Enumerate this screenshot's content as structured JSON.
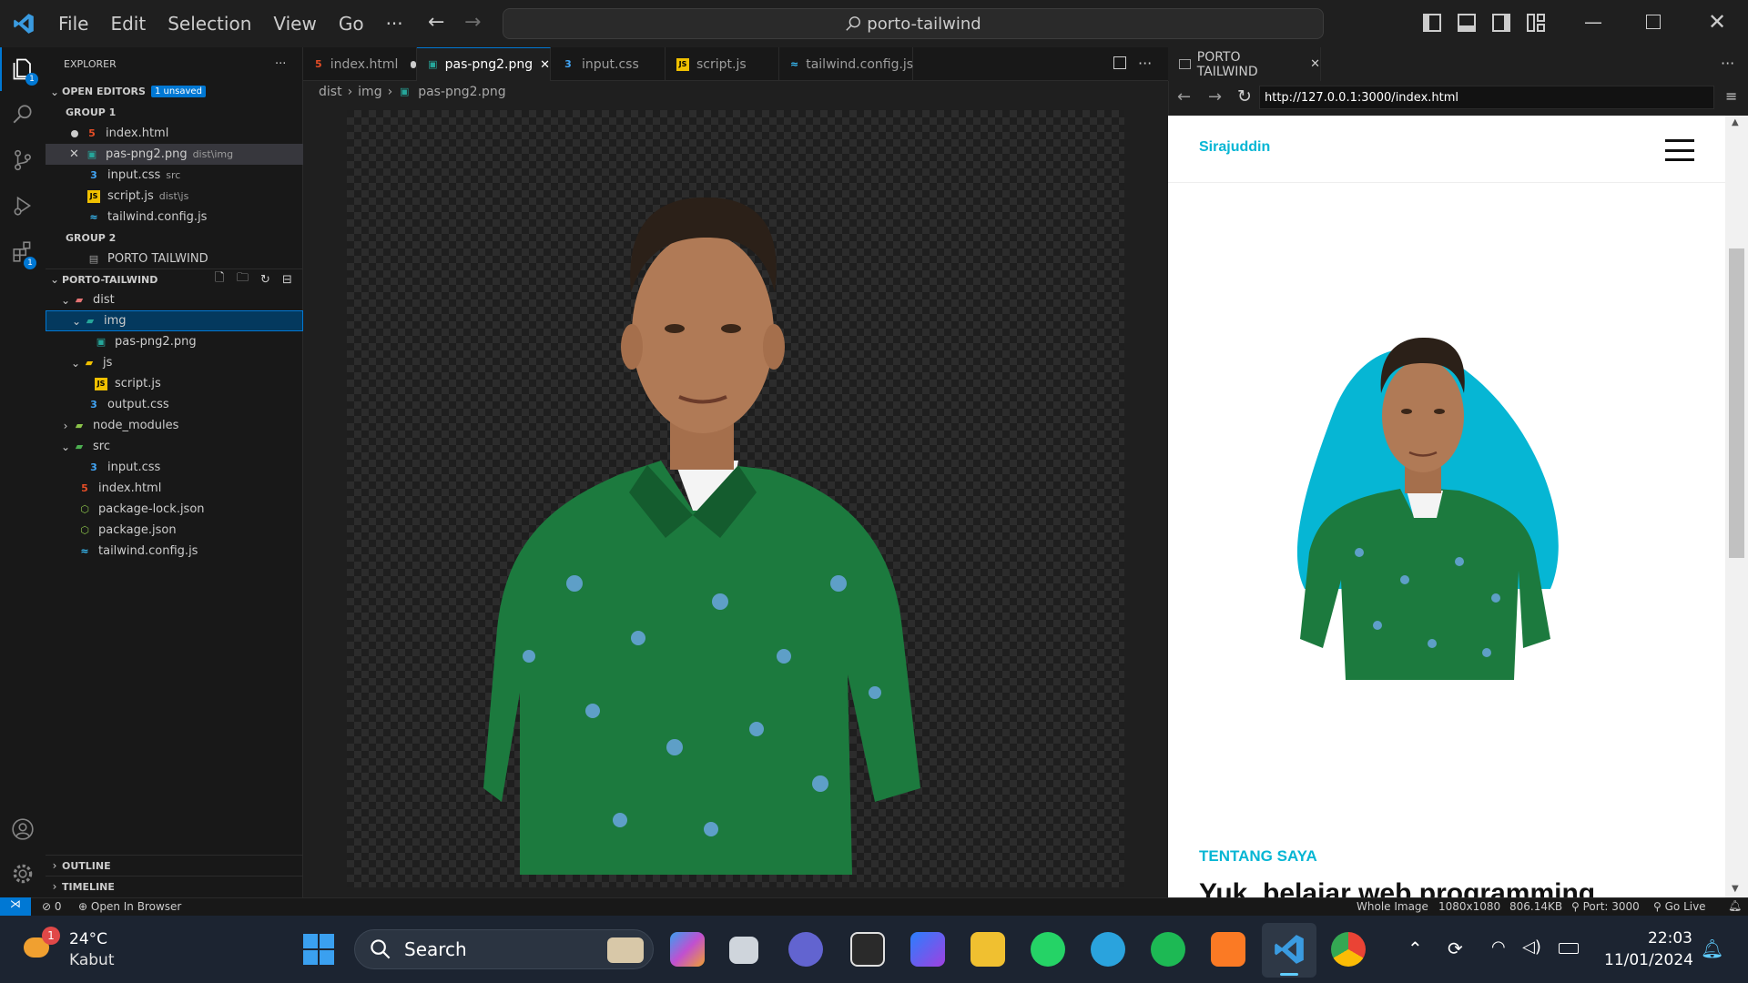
{
  "menu": {
    "file": "File",
    "edit": "Edit",
    "selection": "Selection",
    "view": "View",
    "go": "Go",
    "more": "···"
  },
  "command_center": {
    "text": "porto-tailwind"
  },
  "explorer": {
    "title": "EXPLORER",
    "open_editors": {
      "label": "OPEN EDITORS",
      "badge": "1 unsaved",
      "group1": "GROUP 1",
      "files": [
        {
          "name": "index.html",
          "desc": ""
        },
        {
          "name": "pas-png2.png",
          "desc": "dist\\img"
        },
        {
          "name": "input.css",
          "desc": "src"
        },
        {
          "name": "script.js",
          "desc": "dist\\js"
        },
        {
          "name": "tailwind.config.js",
          "desc": ""
        }
      ],
      "group2": "GROUP 2",
      "group2_item": "PORTO TAILWIND"
    },
    "project": {
      "label": "PORTO-TAILWIND",
      "tree": [
        "dist",
        "img",
        "pas-png2.png",
        "js",
        "script.js",
        "output.css",
        "node_modules",
        "src",
        "input.css",
        "index.html",
        "package-lock.json",
        "package.json",
        "tailwind.config.js"
      ]
    },
    "outline": "OUTLINE",
    "timeline": "TIMELINE"
  },
  "tabs": [
    {
      "label": "index.html"
    },
    {
      "label": "pas-png2.png"
    },
    {
      "label": "input.css"
    },
    {
      "label": "script.js"
    },
    {
      "label": "tailwind.config.js"
    }
  ],
  "breadcrumb": {
    "p1": "dist",
    "p2": "img",
    "p3": "pas-png2.png"
  },
  "preview": {
    "tab": "PORTO TAILWIND",
    "url": "http://127.0.0.1:3000/index.html",
    "brand": "Sirajuddin",
    "section": "TENTANG SAYA",
    "heading": "Yuk, belajar web programming"
  },
  "status": {
    "problems": "0",
    "open_browser": "Open In Browser",
    "whole_image": "Whole Image",
    "dims": "1080x1080",
    "size": "806.14KB",
    "port": "Port: 3000",
    "golive": "Go Live"
  },
  "taskbar": {
    "notif_count": "1",
    "temp": "24°C",
    "weather": "Kabut",
    "search": "Search",
    "time": "22:03",
    "date": "11/01/2024"
  },
  "colors": {
    "accent": "#0078d4",
    "brand": "#06b6d4",
    "shirt": "#1c7a3e",
    "skin": "#b07a56"
  }
}
